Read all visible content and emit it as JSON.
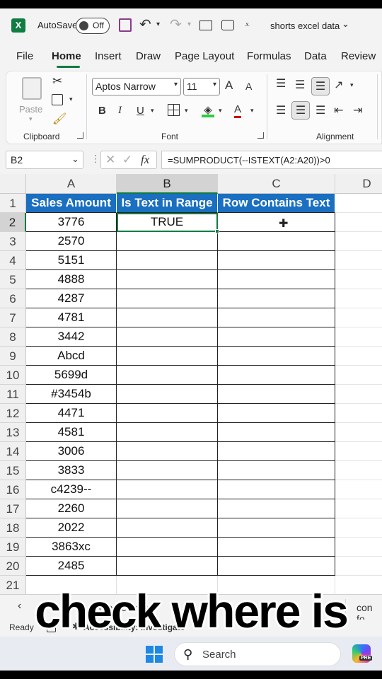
{
  "titlebar": {
    "autosave_label": "AutoSave",
    "autosave_state": "Off",
    "file_name": "shorts excel data"
  },
  "tabs": [
    "File",
    "Home",
    "Insert",
    "Draw",
    "Page Layout",
    "Formulas",
    "Data",
    "Review"
  ],
  "active_tab": "Home",
  "ribbon": {
    "clipboard": {
      "paste_label": "Paste",
      "group_label": "Clipboard"
    },
    "font": {
      "font_name": "Aptos Narrow",
      "font_size": "11",
      "group_label": "Font",
      "bold": "B",
      "italic": "I",
      "underline": "U",
      "grow": "A",
      "shrink": "A",
      "color": "A"
    },
    "alignment": {
      "group_label": "Alignment"
    }
  },
  "formula_bar": {
    "name_box": "B2",
    "fx": "fx",
    "formula": "=SUMPRODUCT(--ISTEXT(A2:A20))>0"
  },
  "grid": {
    "columns": [
      "A",
      "B",
      "C",
      "D"
    ],
    "header_row": [
      "Sales Amount",
      "Is Text in Range",
      "Row Contains Text"
    ],
    "row_numbers": [
      "1",
      "2",
      "3",
      "4",
      "5",
      "6",
      "7",
      "8",
      "9",
      "10",
      "11",
      "12",
      "13",
      "14",
      "15",
      "16",
      "17",
      "18",
      "19",
      "20",
      "21"
    ],
    "column_a": [
      "3776",
      "2570",
      "5151",
      "4888",
      "4287",
      "4781",
      "3442",
      "Abcd",
      "5699d",
      "#3454b",
      "4471",
      "4581",
      "3006",
      "3833",
      "c4239--",
      "2260",
      "2022",
      "3863xc",
      "2485"
    ],
    "b2_value": "TRUE",
    "selected_cell": "B2",
    "header_color": "#1a6fc0"
  },
  "sheetbar": {
    "sheet_fragment_1": "create date",
    "sheet_fragment_2": "con fo"
  },
  "statusbar": {
    "ready": "Ready",
    "accessibility": "Accessibility: Investigate"
  },
  "taskbar": {
    "search_label": "Search",
    "copilot_badge": "PRE"
  },
  "caption": "check where is"
}
